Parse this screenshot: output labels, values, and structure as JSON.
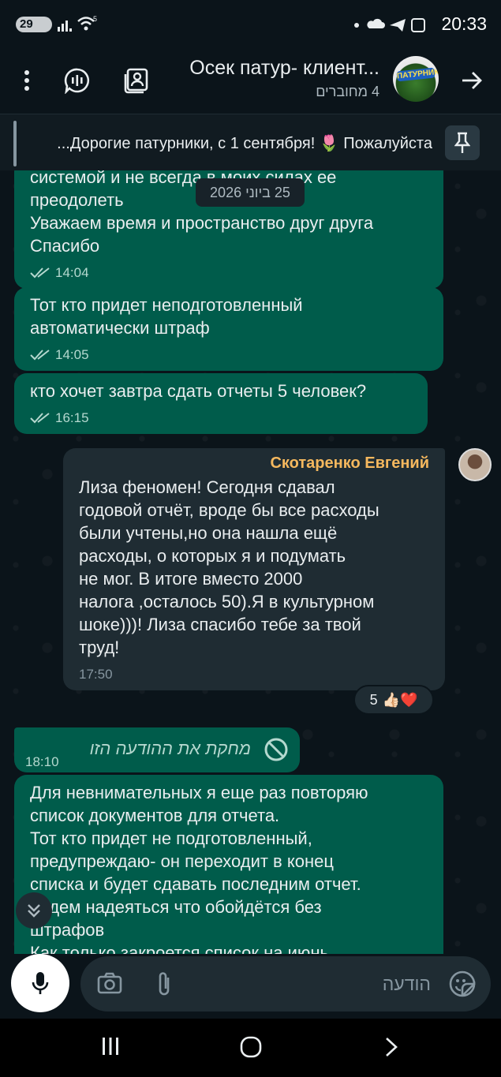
{
  "status_bar": {
    "badge": "29",
    "wifi_label": "5",
    "time": "20:33"
  },
  "header": {
    "title": "Осек патур- клиент...",
    "subtitle": "4 מחוברים",
    "avatar_text": "ПАТУРНИКИ",
    "icons": [
      "more-vert-icon",
      "voice-chat-icon",
      "contact-card-icon",
      "forward-arrow-icon"
    ]
  },
  "pinned": {
    "text": "...Дорогие патурники, с 1 сентября! 🌷 Пожалуйста"
  },
  "date_chip": "25 ביוני 2026",
  "messages": [
    {
      "text": "системой и не всегда в моих силах ее\nпреодолеть\nУважаем время и пространство друг друга\nСпасибо",
      "time": "14:04",
      "outgoing": true
    },
    {
      "text": "Тот кто придет неподготовленный\nавтоматически штраф",
      "time": "14:05",
      "outgoing": true
    },
    {
      "text": "кто хочет завтра сдать отчеты 5 человек?",
      "time": "16:15",
      "outgoing": true
    },
    {
      "sender": "Скотаренко Евгений",
      "text": "Лиза феномен! Сегодня сдавал\nгодовой отчёт, вроде бы все расходы\nбыли учтены,но она нашла ещё\nрасходы, о которых я и подумать\nне мог. В итоге вместо 2000\nналога ,осталось 50).Я в культурном\nшоке)))! Лиза спасибо тебе за твой\nтруд!",
      "time": "17:50",
      "outgoing": false,
      "reactions": {
        "count": "5",
        "emojis": "👍🏻❤️"
      }
    },
    {
      "deleted_text": "מחקת את ההודעה הזו",
      "time": "18:10",
      "outgoing": true
    },
    {
      "text": "Для невнимательных я еще раз повторяю\nсписок документов для отчета.\nТот кто придет не подготовленный,\nпредупреждаю- он переходит в конец\nсписка и будет сдавать последним отчет.\nБудем надеяться что обойдётся без\nштрафов\nКак только закроется список на июнь",
      "outgoing": true
    }
  ],
  "composer": {
    "placeholder": "הודעה",
    "accent": "#00a884"
  },
  "colors": {
    "background": "#0b141a",
    "outgoing_bubble": "#005c4b",
    "incoming_bubble": "#1f2c33",
    "sender_name": "#f5b85e"
  }
}
